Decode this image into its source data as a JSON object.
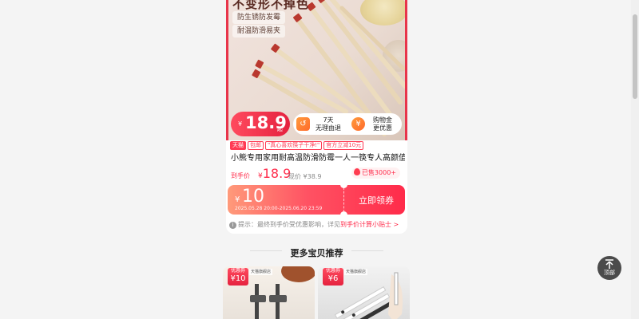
{
  "hero": {
    "headline": "不变形不掉色",
    "features": [
      "防生锈防发霉",
      "耐温防滑易夹"
    ],
    "price_yen": "¥",
    "price": "18.9",
    "price_unit": "起",
    "promos": [
      {
        "icon": "return-icon",
        "text_1": "7天",
        "text_2": "无理由退"
      },
      {
        "icon": "coin-bag-icon",
        "text_1": "购物金",
        "text_2": "更优惠"
      }
    ]
  },
  "product": {
    "tags": [
      "天猫",
      "包邮",
      "\"真心喜欢筷子干净!\"",
      "官方立减10元"
    ],
    "title": "小熊专用家用耐高温防滑防霉一人一筷专人高颜值...",
    "price_label": "到手价",
    "price_yen": "¥",
    "price": "18.9",
    "original_price": "现价 ¥38.9",
    "sold": "已售3000+"
  },
  "coupon": {
    "yen": "¥",
    "amount": "10",
    "date_range": "2025.05.28 20:00-2025.06.20 23:59",
    "claim_label": "立即领券"
  },
  "tip": {
    "text": "提示：最终到手价受优惠影响，详见",
    "link": "到手价计算小贴士 >"
  },
  "section_title": "更多宝贝推荐",
  "recommendations": [
    {
      "badge_label": "优惠券",
      "badge_value": "¥10",
      "shop": "天猫旗舰店"
    },
    {
      "badge_label": "优惠券",
      "badge_value": "¥6",
      "shop": "天猫旗舰店"
    }
  ],
  "back_to_top": {
    "arrow": "↑",
    "label": "顶部"
  },
  "colors": {
    "accent": "#ff2b4a",
    "coupon_start": "#ff9a7a",
    "coupon_end": "#ff2b4a",
    "page_bg": "#f4f4f4"
  }
}
